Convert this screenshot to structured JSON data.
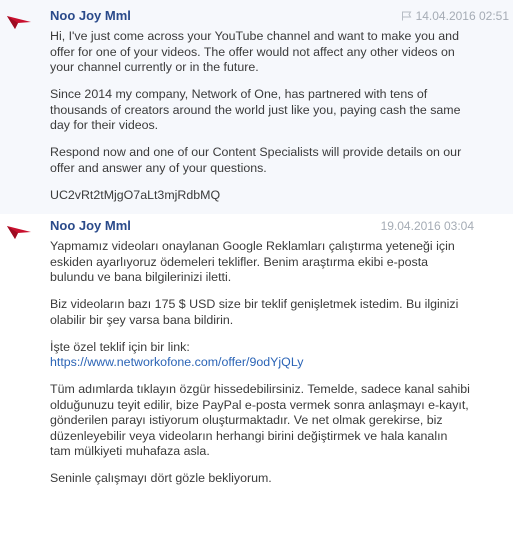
{
  "messages": [
    {
      "author": "Noo Joy Mml",
      "timestamp": "14.04.2016 02:51",
      "paragraphs": [
        "Hi, I've just come across your YouTube channel and want to make you and offer for one of your videos.  The offer would not affect any other videos on your channel currently or in the future.",
        "Since 2014 my company, Network of One, has partnered with tens of thousands of creators around the world just like you, paying cash the same day for their videos.",
        "Respond now and one of our Content Specialists will provide details on our offer and answer any of your questions.",
        "UC2vRt2tMjgO7aLt3mjRdbMQ"
      ]
    },
    {
      "author": "Noo Joy Mml",
      "timestamp": "19.04.2016 03:04",
      "paragraphs": [
        "Yapmamız videoları onaylanan Google Reklamları çalıştırma yeteneği için eskiden ayarlıyoruz ödemeleri teklifler. Benim araştırma ekibi e-posta bulundu ve bana bilgilerinizi iletti.",
        "Biz videoların bazı 175 $ USD size bir teklif genişletmek istedim. Bu ilginizi olabilir bir şey varsa bana bildirin.",
        "İşte özel teklif için bir link:",
        "Tüm adımlarda tıklayın özgür hissedebilirsiniz. Temelde, sadece kanal sahibi olduğunuzu teyit edilir, bize PayPal e-posta vermek sonra anlaşmayı e-kayıt, gönderilen parayı istiyorum oluşturmaktadır. Ve net olmak gerekirse, biz düzenleyebilir veya videoların herhangi birini değiştirmek ve hala kanalın tam mülkiyeti muhafaza asla.",
        "Seninle çalışmayı dört gözle bekliyorum."
      ],
      "link": "https://www.networkofone.com/offer/9odYjQLy"
    }
  ],
  "icons": {
    "avatar": "red-arrow-logo-icon",
    "flag": "flag-icon"
  },
  "colors": {
    "author": "#2a4a8a",
    "link": "#2b64b6",
    "timestamp": "#a5acb5",
    "highlight_bg": "#f6f8fc",
    "avatar": "#c8102e"
  }
}
